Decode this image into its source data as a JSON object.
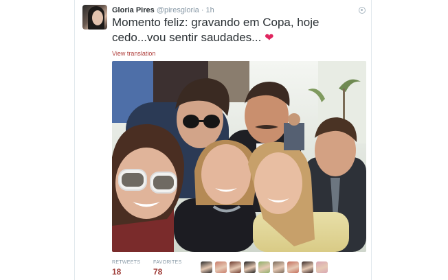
{
  "tweet": {
    "author_name": "Gloria Pires",
    "author_handle": "@piresgloria",
    "separator": "·",
    "time": "1h",
    "text": "Momento feliz: gravando em Copa, hoje cedo...vou sentir saudades...",
    "emoji_icon": "heart-emoji",
    "translate_link": "View translation",
    "photo_description_icon": "selfie-photo",
    "stats": {
      "retweets_label": "RETWEETS",
      "retweets_value": "18",
      "favorites_label": "FAVORITES",
      "favorites_value": "78"
    },
    "favoriter_avatar_colors": [
      "#2b2b2b",
      "#c97d6b",
      "#6d3b2e",
      "#1e1e1e",
      "#8fb06a",
      "#7a6a5a",
      "#c46e5c",
      "#3a2b28",
      "#d9a6b3"
    ]
  },
  "colors": {
    "name_text": "#292f33",
    "meta_text": "#8899a6",
    "link_red": "#b0413e",
    "stat_value_red": "#9e3b37"
  }
}
